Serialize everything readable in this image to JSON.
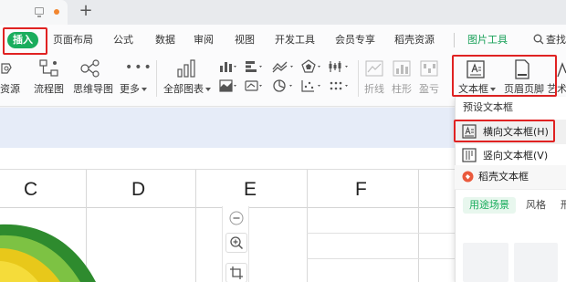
{
  "menu": {
    "insert": "插入",
    "items": [
      "页面布局",
      "公式",
      "数据",
      "审阅",
      "视图",
      "开发工具",
      "会员专享",
      "稻壳资源"
    ],
    "picture_tools": "图片工具",
    "search": "查找"
  },
  "ribbon": {
    "resource": "资源",
    "flowchart": "流程图",
    "mindmap": "思维导图",
    "more": "更多",
    "all_charts": "全部图表",
    "sparkline_line": "折线",
    "sparkline_column": "柱形",
    "sparkline_winloss": "盈亏",
    "textbox": "文本框",
    "header_footer": "页眉页脚",
    "art_text": "艺术"
  },
  "columns": [
    "C",
    "D",
    "E",
    "F"
  ],
  "dropdown": {
    "title": "预设文本框",
    "horizontal": "横向文本框(H)",
    "vertical": "竖向文本框(V)",
    "docer": "稻壳文本框",
    "tabs": [
      "用途场景",
      "风格",
      "形"
    ]
  },
  "colors": {
    "accent_green": "#1aad5d",
    "highlight_red": "#e02222",
    "formula_bg": "#e6ecf8"
  }
}
